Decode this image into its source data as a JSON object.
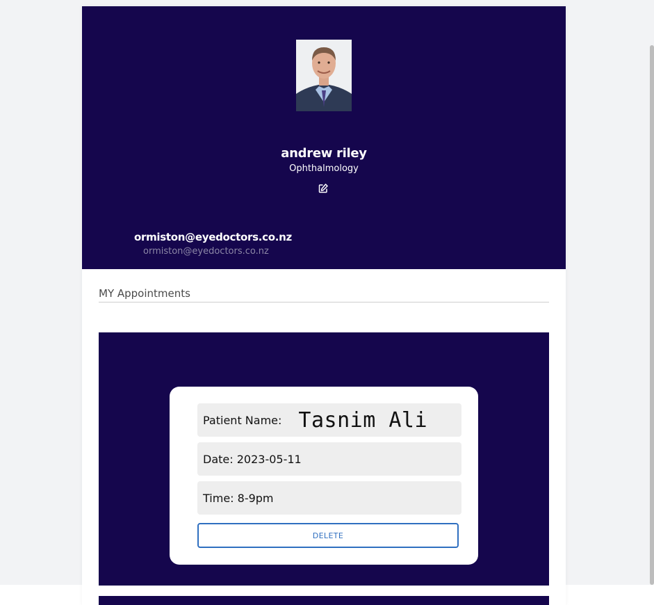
{
  "profile": {
    "name": "andrew riley",
    "specialty": "Ophthalmology",
    "email_primary": "ormiston@eyedoctors.co.nz",
    "email_secondary": "ormiston@eyedoctors.co.nz",
    "avatar_icon": "doctor-portrait",
    "edit_icon": "edit-icon"
  },
  "appointments": {
    "title": "MY Appointments",
    "items": [
      {
        "patient_label": "Patient Name:",
        "patient_name": "Tasnim Ali",
        "date_text": "Date: 2023-05-11",
        "time_text": "Time: 8-9pm",
        "delete_label": "DELETE"
      }
    ]
  },
  "colors": {
    "primary": "#15064d",
    "accent": "#2f6fc0",
    "field_bg": "#eeeeee",
    "page_bg": "#f2f3f5"
  }
}
